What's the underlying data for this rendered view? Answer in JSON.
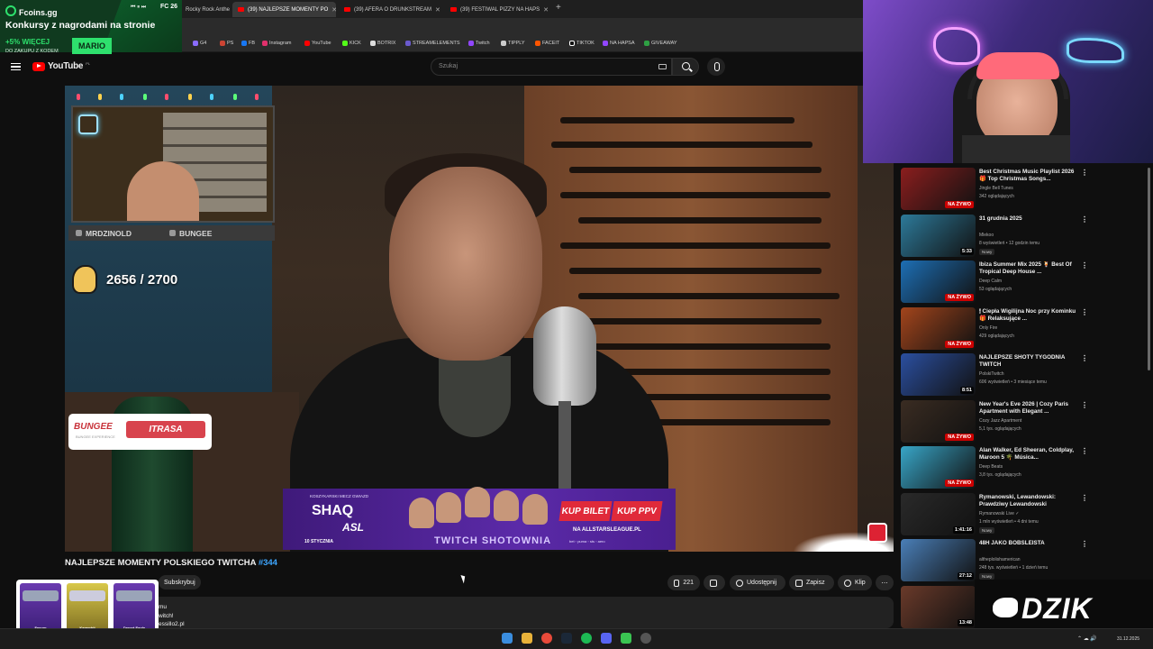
{
  "browser": {
    "tabs": [
      {
        "label": "Rocky Rock Anthe"
      },
      {
        "label": "(39) NAJLEPSZE MOMENTY PO"
      },
      {
        "label": "(39) AFERA O DRUNKSTREAM"
      },
      {
        "label": "(39) FESTIWAL PIZZY NA HAPS"
      }
    ],
    "new_tab": "+",
    "bookmarks": [
      "G4",
      "PS",
      "FB",
      "Instagram",
      "YouTube",
      "KICK",
      "BOTRIX",
      "STREAMELEMENTS",
      "Twitch",
      "TIPPLY",
      "FACEIT",
      "TIKTOK",
      "NA HAPSA",
      "GIVEAWAY"
    ]
  },
  "fcoins_overlay": {
    "brand": "Fcoins.gg",
    "promo": "Konkursy z nagrodami na stronie",
    "bonus": "+5% WIĘCEJ",
    "bonus_sub": "DO ZAKUPU Z KODEM",
    "code": "MARIO",
    "ctrl": "⏮ ⏸ ⏭",
    "game": "FC 26"
  },
  "youtube": {
    "logo_text": "YouTube",
    "logo_region": "PL",
    "search_placeholder": "Szukaj"
  },
  "video": {
    "facecam_socials": [
      {
        "label": "MRDZINOLD"
      },
      {
        "label": "BUNGEE"
      }
    ],
    "score": "2656 / 2700",
    "bungee_logo": "BUNGEE",
    "bungee_logo_sub": "BUNGEE EXPERIENCE",
    "bungee_pill": "ITRASA",
    "asl": {
      "line1": "KOSZYKARSKI MECZ GWIAZD",
      "shaq": "SHAQ",
      "asl": "ASL",
      "date": "10 STYCZNIA",
      "twitch": "TWITCH SHOTOWNIA",
      "buy_ticket": "KUP BILET",
      "buy_ppv": "KUP PPV",
      "site": "NA ALLSTARSLEAGUE.PL",
      "sponsors": "bet ◦ puma ◦ sts ◦ aero"
    }
  },
  "video_info": {
    "title": "NAJLEPSZE MOMENTY POLSKIEGO TWITCHA",
    "tag": "#344",
    "subscribe_label": "Subskrybuj",
    "likes": "221",
    "share_label": "Udostępnij",
    "save_label": "Zapisz",
    "clip_label": "Klip",
    "more": "⋯",
    "desc_lines": [
      "mu",
      "witch!",
      "essillo2.pl"
    ]
  },
  "cards": [
    {
      "label": "Fenum"
    },
    {
      "label": "Karambit"
    },
    {
      "label": "Desert Eagle"
    }
  ],
  "sidebar": {
    "items": [
      {
        "title": "Best Christmas Music Playlist 2026 🎁 Top Christmas Songs...",
        "channel": "Jingle Bell Tunes",
        "meta": "342 oglądających",
        "badge": "NA ŻYWO",
        "nowy": "",
        "thumb": "#8b1e1e"
      },
      {
        "title": "31 grudnia 2025",
        "channel": "Mlekoo",
        "meta": "8 wyświetleń • 12 godzin temu",
        "badge": "5:33",
        "nowy": "Nowy",
        "thumb": "#2d7a9a"
      },
      {
        "title": "Ibiza Summer Mix 2025 🍹 Best Of Tropical Deep House ...",
        "channel": "Deep Calm",
        "meta": "53 oglądających",
        "badge": "NA ŻYWO",
        "nowy": "",
        "thumb": "#1d6fb5"
      },
      {
        "title": "🕯 Ciepła Wigilijna Noc przy Kominku 🎁 Relaksujące ...",
        "channel": "Only Fire",
        "meta": "429 oglądających",
        "badge": "NA ŻYWO",
        "nowy": "",
        "thumb": "#a3451c"
      },
      {
        "title": "NAJLEPSZE SHOTY TYGODNIA TWITCH",
        "channel": "PolskiTwitch",
        "meta": "606 wyświetleń • 3 miesiące temu",
        "badge": "8:51",
        "nowy": "",
        "thumb": "#2b4fa0"
      },
      {
        "title": "New Year's Eve 2026 | Cozy Paris Apartment with Elegant ...",
        "channel": "Cozy Jazz Apartment",
        "meta": "5,1 tys. oglądających",
        "badge": "NA ŻYWO",
        "nowy": "",
        "thumb": "#3a2c22"
      },
      {
        "title": "Alan Walker, Ed Sheeran, Coldplay, Maroon 5 🌴 Música...",
        "channel": "Deep Beats",
        "meta": "3,8 tys. oglądających",
        "badge": "NA ŻYWO",
        "nowy": "",
        "thumb": "#38a6c8"
      },
      {
        "title": "Rymanowski, Lewandowski: Prawdziwy Lewandowski",
        "channel": "Rymanowski Live ✓",
        "meta": "1 mln wyświetleń • 4 dni temu",
        "badge": "1:41:16",
        "nowy": "Nowy",
        "thumb": "#2a2a2a"
      },
      {
        "title": "48H JAKO BOBSLEISTA",
        "channel": "altheplolishamerican",
        "meta": "248 tys. wyświetleń • 1 dzień temu",
        "badge": "27:12",
        "nowy": "Nowy",
        "thumb": "#4a7fb8"
      },
      {
        "title": "",
        "channel": "",
        "meta": "",
        "badge": "13:48",
        "nowy": "",
        "thumb": "#6a3a2a"
      }
    ]
  },
  "dzik": "DZIK",
  "taskbar": {
    "clock": "31.12.2025",
    "tray": "⌃  ☁  🔊"
  },
  "colors": {
    "yt_red": "#ff0000",
    "live_red": "#cc0000",
    "link_blue": "#3ea6ff",
    "fcoins_green": "#2ee06d",
    "asl_purple": "#5b2aa8"
  }
}
